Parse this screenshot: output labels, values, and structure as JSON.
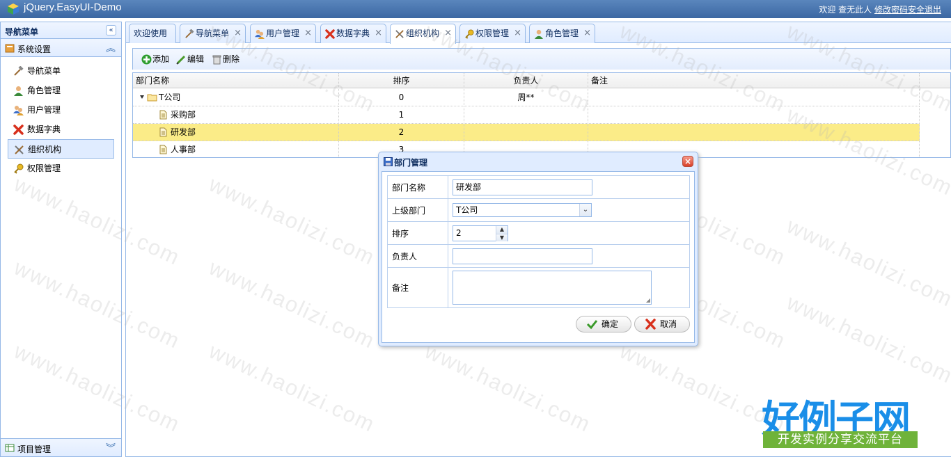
{
  "header": {
    "app_title": "jQuery.EasyUI-Demo",
    "welcome_text": "欢迎 查无此人",
    "change_password": "修改密码",
    "logout": "安全退出"
  },
  "sidebar": {
    "title": "导航菜单",
    "section_title": "系统设置",
    "items": [
      {
        "label": "导航菜单",
        "icon": "hammer-icon"
      },
      {
        "label": "角色管理",
        "icon": "user-icon"
      },
      {
        "label": "用户管理",
        "icon": "users-icon"
      },
      {
        "label": "数据字典",
        "icon": "red-x-icon"
      },
      {
        "label": "组织机构",
        "icon": "tools-icon",
        "selected": true
      },
      {
        "label": "权限管理",
        "icon": "key-icon"
      }
    ],
    "bottom_section": "项目管理"
  },
  "tabs": [
    {
      "label": "欢迎使用",
      "closable": false
    },
    {
      "label": "导航菜单",
      "icon": "hammer-icon",
      "closable": true
    },
    {
      "label": "用户管理",
      "icon": "users-icon",
      "closable": true
    },
    {
      "label": "数据字典",
      "icon": "red-x-icon",
      "closable": true
    },
    {
      "label": "组织机构",
      "icon": "tools-icon",
      "closable": true,
      "active": true
    },
    {
      "label": "权限管理",
      "icon": "key-icon",
      "closable": true
    },
    {
      "label": "角色管理",
      "icon": "user-icon",
      "closable": true
    }
  ],
  "toolbar": {
    "add": "添加",
    "edit": "编辑",
    "delete": "删除"
  },
  "grid": {
    "columns": [
      "部门名称",
      "排序",
      "负责人",
      "备注"
    ],
    "rows": [
      {
        "name": "T公司",
        "sort": "0",
        "manager": "周**",
        "remark": ""
      },
      {
        "name": "采购部",
        "sort": "1",
        "manager": "",
        "remark": ""
      },
      {
        "name": "研发部",
        "sort": "2",
        "manager": "",
        "remark": ""
      },
      {
        "name": "人事部",
        "sort": "3",
        "manager": "",
        "remark": ""
      }
    ]
  },
  "dialog": {
    "title": "部门管理",
    "labels": {
      "name": "部门名称",
      "parent": "上级部门",
      "sort": "排序",
      "manager": "负责人",
      "remark": "备注"
    },
    "values": {
      "name": "研发部",
      "parent": "T公司",
      "sort": "2",
      "manager": "",
      "remark": ""
    },
    "ok": "确定",
    "cancel": "取消"
  },
  "watermark": {
    "text": "www.haolizi.com",
    "brand": "好例子网",
    "brand_sub": "开发实例分享交流平台"
  }
}
